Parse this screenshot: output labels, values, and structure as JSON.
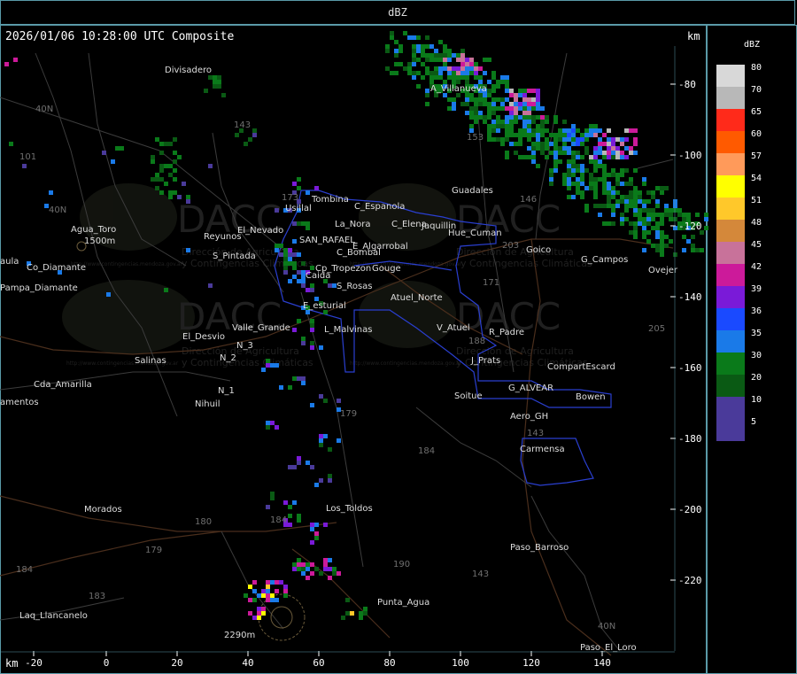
{
  "header": {
    "title": "dBZ"
  },
  "map": {
    "timestamp": "2026/01/06 10:28:00 UTC Composite",
    "km_label_top": "km",
    "km_label_bottom": "km",
    "x_ticks": [
      "-20",
      "0",
      "20",
      "40",
      "60",
      "80",
      "100",
      "120",
      "140"
    ],
    "y_ticks": [
      "-80",
      "-100",
      "-120",
      "-140",
      "-160",
      "-180",
      "-200",
      "-220"
    ],
    "places": [
      "Divisadero",
      "A_Villanueva",
      "Agua_Toro",
      "1500m",
      "Reyunos",
      "S_Pintada",
      "El_Desvio",
      "Salinas",
      "Cda_Amarilla",
      "amentos",
      "Nihuil",
      "N_1",
      "N_2",
      "N_3",
      "Valle_Grande",
      "L_Malvinas",
      "E_esturial",
      "S_Rosas",
      "Tombina",
      "Usillal",
      "C_Espanola",
      "La_Nora",
      "C_Elena",
      "Jaquillin",
      "Hue_Cuman",
      "SAN_RAFAEL",
      "E_Algarrobal",
      "C_Bombal",
      "Cp_Tropezon",
      "Gouge",
      "Caida",
      "Atuel_Norte",
      "V_Atuel",
      "R_Padre",
      "J_Prats",
      "CompartEscard",
      "G_ALVEAR",
      "Bowen",
      "Soitue",
      "Aero_GH",
      "Carmensa",
      "Guadales",
      "Goico",
      "G_Campos",
      "Ovejer",
      "Los_Toldos",
      "Morados",
      "Laq_Llancanelo",
      "2290m",
      "Punta_Agua",
      "Paso_Barroso",
      "Paso_El_Loro",
      "aula",
      "Pampa_Diamante",
      "Co_Diamante",
      "El_Nevado"
    ],
    "routes": [
      "40N",
      "101",
      "40N",
      "143",
      "153",
      "146",
      "203",
      "171",
      "188",
      "173",
      "205",
      "143",
      "184",
      "179",
      "180",
      "184",
      "183",
      "184",
      "179",
      "190",
      "143",
      "40N"
    ],
    "watermark": {
      "brand": "DACC",
      "line1": "Dirección de Agricultura",
      "line2": "y Contingencias Climáticas",
      "url": "http://www.contingencias.mendoza.gov.ar"
    }
  },
  "legend": {
    "unit": "dBZ",
    "levels": [
      {
        "label": "80",
        "color": "#d8d8d8"
      },
      {
        "label": "70",
        "color": "#b8b8b8"
      },
      {
        "label": "65",
        "color": "#ff2a1a"
      },
      {
        "label": "60",
        "color": "#ff5a00"
      },
      {
        "label": "57",
        "color": "#ff9a5a"
      },
      {
        "label": "54",
        "color": "#ffff00"
      },
      {
        "label": "51",
        "color": "#ffc82a"
      },
      {
        "label": "48",
        "color": "#d4883a"
      },
      {
        "label": "45",
        "color": "#c8729a"
      },
      {
        "label": "42",
        "color": "#cc1a9a"
      },
      {
        "label": "39",
        "color": "#7a1ad8"
      },
      {
        "label": "36",
        "color": "#1a4aff"
      },
      {
        "label": "35",
        "color": "#1a7ae8"
      },
      {
        "label": "30",
        "color": "#0a7a1a"
      },
      {
        "label": "20",
        "color": "#0a5a14"
      },
      {
        "label": "10",
        "color": "#4a3a9a"
      },
      {
        "label": "5",
        "color": "#4a3a9a"
      }
    ]
  }
}
